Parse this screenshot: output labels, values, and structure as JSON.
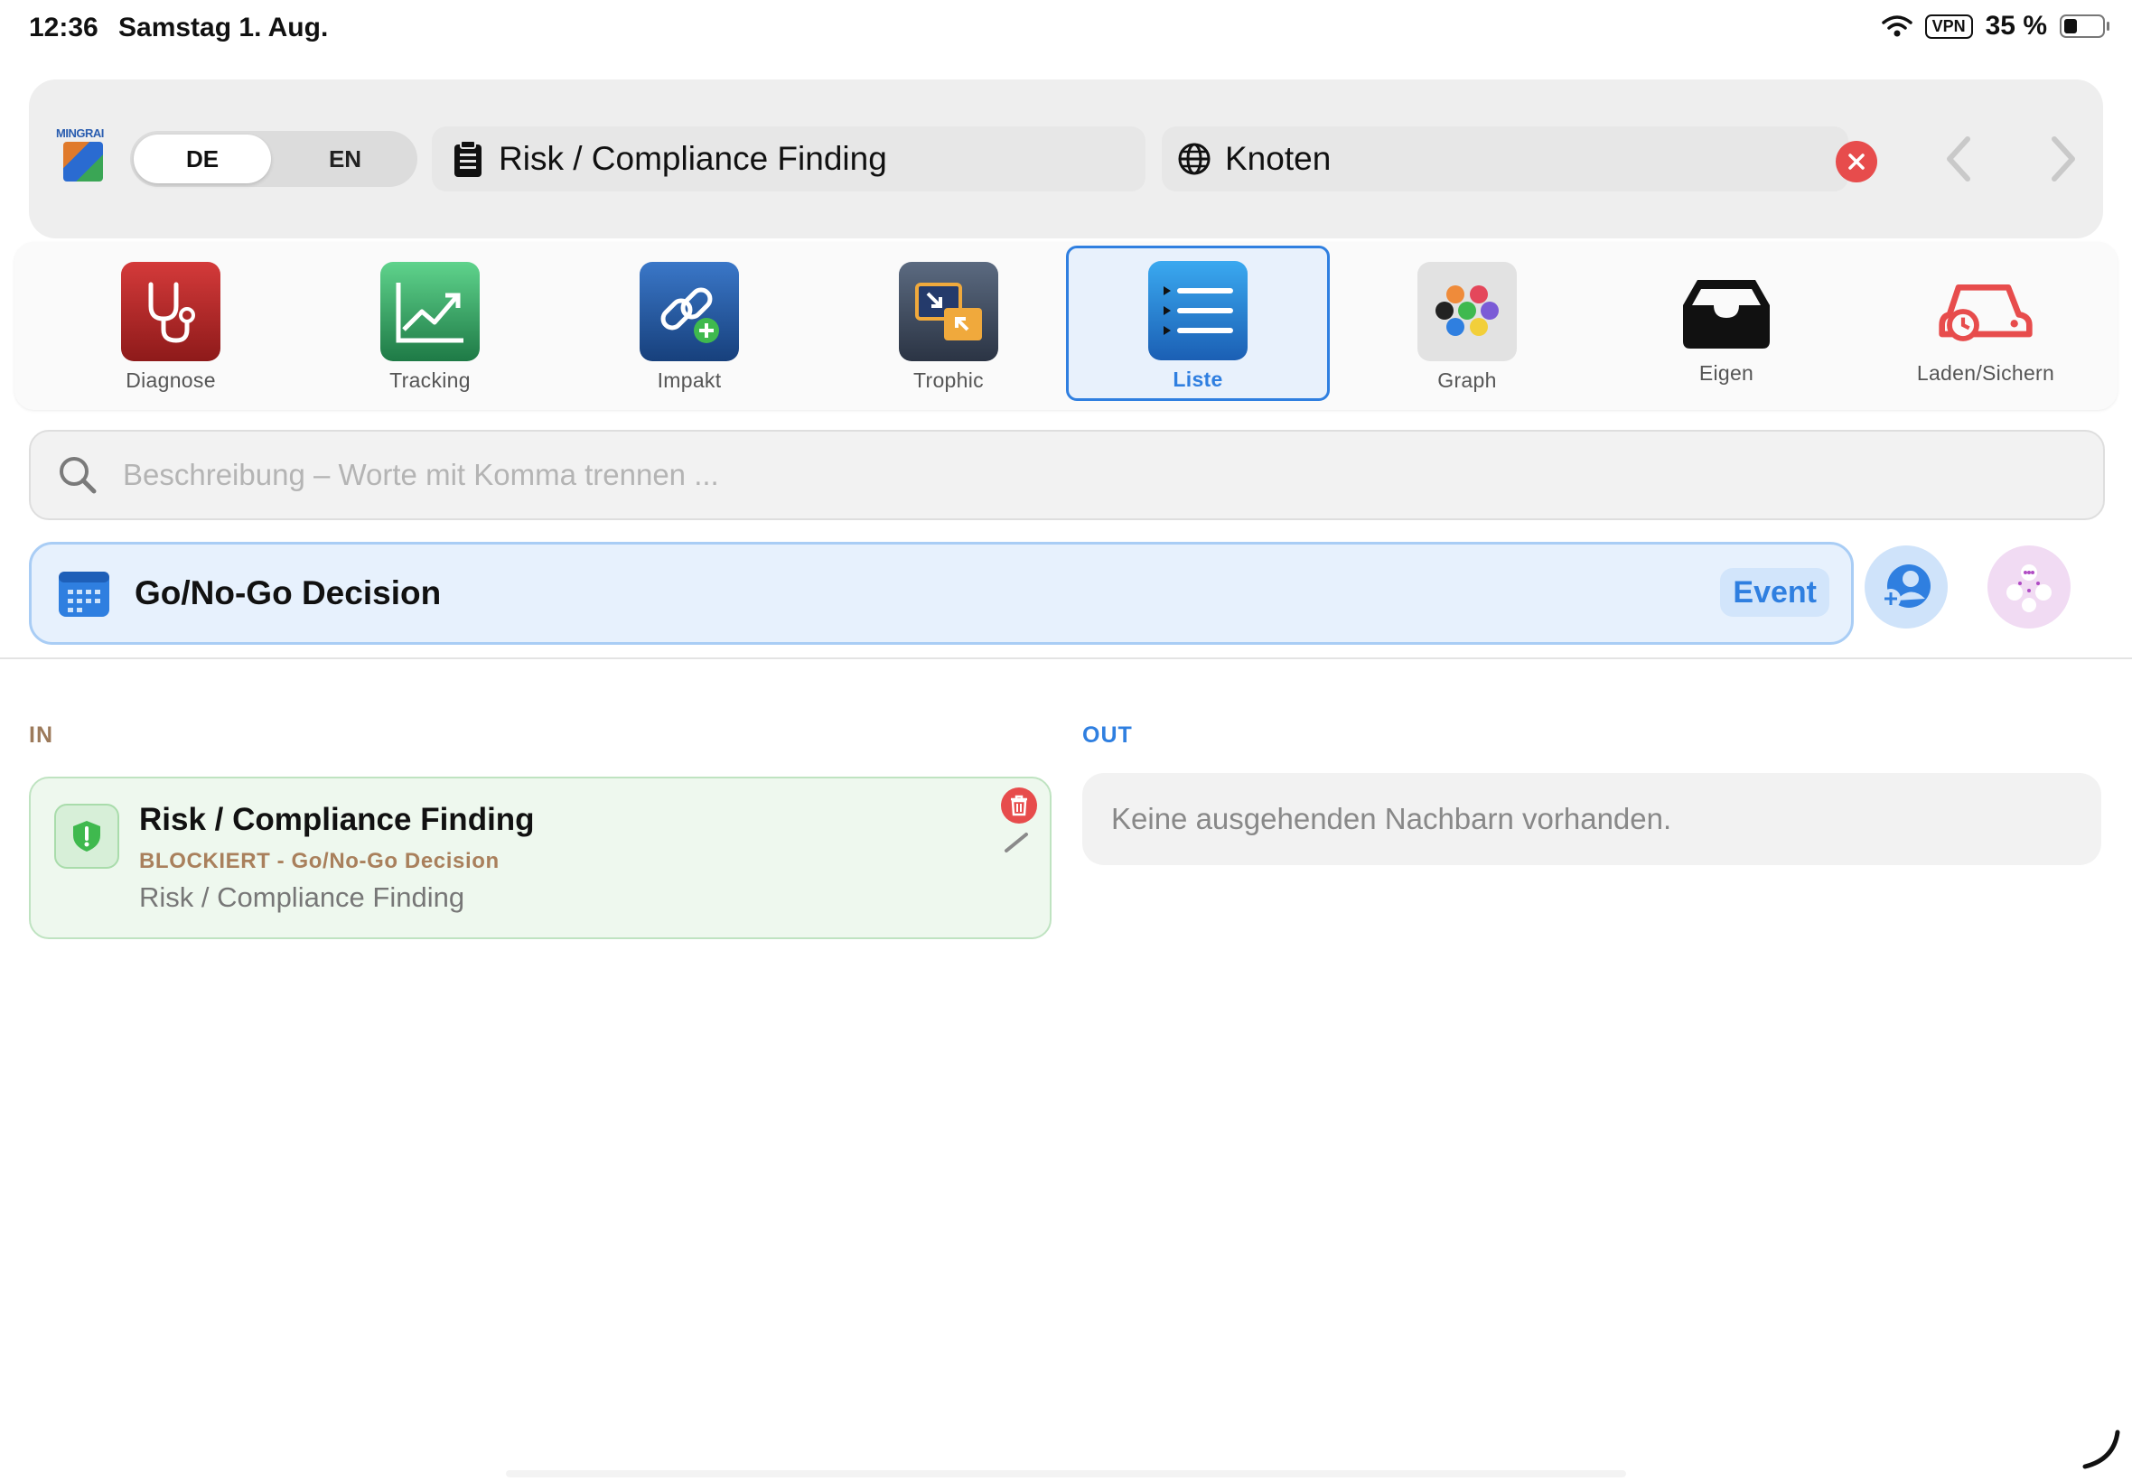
{
  "status": {
    "time": "12:36",
    "date": "Samstag 1. Aug.",
    "vpn": "VPN",
    "battery": "35 %"
  },
  "header": {
    "logo_text": "MINGRAI",
    "lang_de": "DE",
    "lang_en": "EN",
    "breadcrumb": "Risk / Compliance Finding",
    "scope": "Knoten"
  },
  "tabs": [
    {
      "label": "Diagnose",
      "icon": "stethoscope-icon"
    },
    {
      "label": "Tracking",
      "icon": "chart-up-icon"
    },
    {
      "label": "Impakt",
      "icon": "link-plus-icon"
    },
    {
      "label": "Trophic",
      "icon": "arrows-in-out-icon"
    },
    {
      "label": "Liste",
      "icon": "list-icon",
      "active": true
    },
    {
      "label": "Graph",
      "icon": "dots-icon"
    },
    {
      "label": "Eigen",
      "icon": "tray-icon"
    },
    {
      "label": "Laden/Sichern",
      "icon": "car-history-icon"
    }
  ],
  "search": {
    "placeholder": "Beschreibung – Worte mit Komma trennen ..."
  },
  "node": {
    "title": "Go/No-Go Decision",
    "badge": "Event"
  },
  "in": {
    "label": "IN",
    "items": [
      {
        "title": "Risk / Compliance Finding",
        "relation": "BLOCKIERT - Go/No-Go Decision",
        "subtitle": "Risk / Compliance Finding"
      }
    ]
  },
  "out": {
    "label": "OUT",
    "empty": "Keine ausgehenden Nachbarn vorhanden."
  },
  "colors": {
    "accent": "#2f7fe0",
    "danger": "#e74c4c",
    "in_label": "#9c7a5b",
    "in_card_bg": "#eef8ee"
  }
}
